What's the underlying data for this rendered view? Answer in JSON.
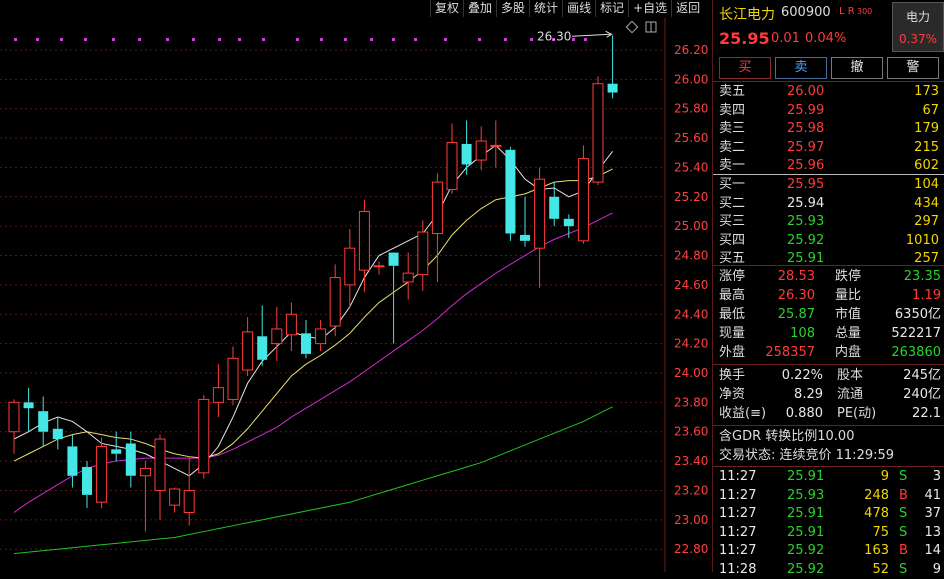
{
  "toolbar": [
    "复权",
    "叠加",
    "多股",
    "统计",
    "画线",
    "标记",
    "+自选",
    "返回"
  ],
  "chart_data": {
    "type": "candlestick",
    "y_ticks": [
      "26.20",
      "26.00",
      "25.80",
      "25.60",
      "25.40",
      "25.20",
      "25.00",
      "24.80",
      "24.60",
      "24.40",
      "24.20",
      "24.00",
      "23.80",
      "23.60",
      "23.40",
      "23.20",
      "23.00",
      "22.80"
    ],
    "ylim": [
      22.74,
      26.37
    ],
    "high_label": "26.30",
    "candles": [
      {
        "o": 23.6,
        "c": 23.8,
        "h": 23.82,
        "l": 23.45
      },
      {
        "o": 23.8,
        "c": 23.76,
        "h": 23.9,
        "l": 23.6
      },
      {
        "o": 23.74,
        "c": 23.6,
        "h": 23.84,
        "l": 23.5
      },
      {
        "o": 23.62,
        "c": 23.55,
        "h": 23.7,
        "l": 23.48
      },
      {
        "o": 23.5,
        "c": 23.3,
        "h": 23.58,
        "l": 23.22
      },
      {
        "o": 23.36,
        "c": 23.17,
        "h": 23.4,
        "l": 23.08
      },
      {
        "o": 23.12,
        "c": 23.5,
        "h": 23.56,
        "l": 23.08
      },
      {
        "o": 23.48,
        "c": 23.45,
        "h": 23.6,
        "l": 23.4
      },
      {
        "o": 23.52,
        "c": 23.3,
        "h": 23.6,
        "l": 23.22
      },
      {
        "o": 23.3,
        "c": 23.35,
        "h": 23.4,
        "l": 22.92
      },
      {
        "o": 23.2,
        "c": 23.55,
        "h": 23.58,
        "l": 23.0
      },
      {
        "o": 23.1,
        "c": 23.21,
        "h": 23.22,
        "l": 23.05
      },
      {
        "o": 23.05,
        "c": 23.2,
        "h": 23.42,
        "l": 22.96
      },
      {
        "o": 23.32,
        "c": 23.82,
        "h": 23.85,
        "l": 23.28
      },
      {
        "o": 23.8,
        "c": 23.9,
        "h": 24.06,
        "l": 23.7
      },
      {
        "o": 23.82,
        "c": 24.1,
        "h": 24.18,
        "l": 23.78
      },
      {
        "o": 24.02,
        "c": 24.28,
        "h": 24.38,
        "l": 23.98
      },
      {
        "o": 24.25,
        "c": 24.09,
        "h": 24.46,
        "l": 24.05
      },
      {
        "o": 24.2,
        "c": 24.3,
        "h": 24.45,
        "l": 24.08
      },
      {
        "o": 24.26,
        "c": 24.4,
        "h": 24.48,
        "l": 24.15
      },
      {
        "o": 24.27,
        "c": 24.13,
        "h": 24.36,
        "l": 24.1
      },
      {
        "o": 24.2,
        "c": 24.3,
        "h": 24.36,
        "l": 24.15
      },
      {
        "o": 24.32,
        "c": 24.65,
        "h": 24.74,
        "l": 24.25
      },
      {
        "o": 24.6,
        "c": 24.85,
        "h": 24.98,
        "l": 24.45
      },
      {
        "o": 24.7,
        "c": 25.1,
        "h": 25.18,
        "l": 24.55
      },
      {
        "o": 24.73,
        "c": 24.73,
        "h": 24.76,
        "l": 24.67
      },
      {
        "o": 24.82,
        "c": 24.73,
        "h": 24.82,
        "l": 24.2
      },
      {
        "o": 24.62,
        "c": 24.68,
        "h": 24.82,
        "l": 24.5
      },
      {
        "o": 24.67,
        "c": 24.96,
        "h": 25.04,
        "l": 24.56
      },
      {
        "o": 24.95,
        "c": 25.3,
        "h": 25.36,
        "l": 24.62
      },
      {
        "o": 25.25,
        "c": 25.57,
        "h": 25.7,
        "l": 25.22
      },
      {
        "o": 25.56,
        "c": 25.42,
        "h": 25.72,
        "l": 25.35
      },
      {
        "o": 25.45,
        "c": 25.58,
        "h": 25.68,
        "l": 25.38
      },
      {
        "o": 25.55,
        "c": 25.55,
        "h": 25.72,
        "l": 25.4
      },
      {
        "o": 25.52,
        "c": 24.95,
        "h": 25.54,
        "l": 24.9
      },
      {
        "o": 24.94,
        "c": 24.9,
        "h": 25.2,
        "l": 24.86
      },
      {
        "o": 24.85,
        "c": 25.32,
        "h": 25.4,
        "l": 24.58
      },
      {
        "o": 25.2,
        "c": 25.05,
        "h": 25.3,
        "l": 25.0
      },
      {
        "o": 25.05,
        "c": 25.0,
        "h": 25.08,
        "l": 24.92
      },
      {
        "o": 24.9,
        "c": 25.46,
        "h": 25.55,
        "l": 24.88
      },
      {
        "o": 25.3,
        "c": 25.97,
        "h": 26.02,
        "l": 25.28
      },
      {
        "o": 25.97,
        "c": 25.91,
        "h": 26.3,
        "l": 25.87
      }
    ],
    "ma5": [
      23.55,
      23.6,
      23.66,
      23.7,
      23.67,
      23.6,
      23.52,
      23.5,
      23.48,
      23.45,
      23.4,
      23.35,
      23.3,
      23.38,
      23.5,
      23.7,
      23.93,
      24.08,
      24.18,
      24.28,
      24.25,
      24.23,
      24.31,
      24.45,
      24.65,
      24.8,
      24.85,
      24.9,
      24.95,
      25.08,
      25.28,
      25.4,
      25.48,
      25.55,
      25.45,
      25.32,
      25.25,
      25.26,
      25.2,
      25.24,
      25.38,
      25.51
    ],
    "ma10": [
      23.4,
      23.45,
      23.5,
      23.55,
      23.58,
      23.6,
      23.58,
      23.56,
      23.55,
      23.52,
      23.48,
      23.45,
      23.43,
      23.42,
      23.45,
      23.52,
      23.62,
      23.74,
      23.86,
      23.98,
      24.06,
      24.12,
      24.19,
      24.27,
      24.38,
      24.48,
      24.55,
      24.62,
      24.7,
      24.8,
      24.94,
      25.04,
      25.12,
      25.18,
      25.2,
      25.22,
      25.26,
      25.3,
      25.31,
      25.31,
      25.34,
      25.39
    ],
    "ma20": [
      23.05,
      23.12,
      23.18,
      23.24,
      23.3,
      23.35,
      23.38,
      23.4,
      23.41,
      23.42,
      23.42,
      23.42,
      23.42,
      23.42,
      23.44,
      23.48,
      23.53,
      23.58,
      23.63,
      23.7,
      23.76,
      23.82,
      23.88,
      23.94,
      24.01,
      24.08,
      24.15,
      24.22,
      24.29,
      24.37,
      24.46,
      24.54,
      24.61,
      24.68,
      24.74,
      24.8,
      24.86,
      24.91,
      24.95,
      24.99,
      25.04,
      25.09
    ],
    "ma60": [
      22.77,
      22.78,
      22.79,
      22.8,
      22.81,
      22.82,
      22.83,
      22.84,
      22.85,
      22.86,
      22.87,
      22.88,
      22.9,
      22.92,
      22.94,
      22.96,
      22.98,
      23.0,
      23.02,
      23.04,
      23.06,
      23.08,
      23.1,
      23.12,
      23.15,
      23.18,
      23.21,
      23.24,
      23.27,
      23.3,
      23.33,
      23.36,
      23.39,
      23.43,
      23.47,
      23.51,
      23.55,
      23.59,
      23.63,
      23.67,
      23.72,
      23.77
    ]
  },
  "quote": {
    "name": "长江电力",
    "code": "600900",
    "tag": "L R",
    "tag_num": "300",
    "sector": "电力",
    "sector_pct": "0.37%",
    "price": "25.95",
    "change": "0.01",
    "pct": "0.04%",
    "buttons": [
      "买",
      "卖",
      "撤",
      "警"
    ],
    "asks": [
      {
        "label": "卖五",
        "price": "26.00",
        "vol": "173"
      },
      {
        "label": "卖四",
        "price": "25.99",
        "vol": "67"
      },
      {
        "label": "卖三",
        "price": "25.98",
        "vol": "179"
      },
      {
        "label": "卖二",
        "price": "25.97",
        "vol": "215"
      },
      {
        "label": "卖一",
        "price": "25.96",
        "vol": "602"
      }
    ],
    "bids": [
      {
        "label": "买一",
        "price": "25.95",
        "vol": "104"
      },
      {
        "label": "买二",
        "price": "25.94",
        "vol": "434"
      },
      {
        "label": "买三",
        "price": "25.93",
        "vol": "297"
      },
      {
        "label": "买四",
        "price": "25.92",
        "vol": "1010"
      },
      {
        "label": "买五",
        "price": "25.91",
        "vol": "257"
      }
    ],
    "stats": [
      {
        "l1": "涨停",
        "v1": "28.53",
        "l2": "跌停",
        "v2": "23.35"
      },
      {
        "l1": "最高",
        "v1": "26.30",
        "l2": "量比",
        "v2": "1.19"
      },
      {
        "l1": "最低",
        "v1": "25.87",
        "l2": "市值",
        "v2": "6350亿"
      },
      {
        "l1": "现量",
        "v1": "108",
        "l2": "总量",
        "v2": "522217"
      },
      {
        "l1": "外盘",
        "v1": "258357",
        "l2": "内盘",
        "v2": "263860"
      }
    ],
    "fund": [
      {
        "l1": "换手",
        "v1": "0.22%",
        "l2": "股本",
        "v2": "245亿"
      },
      {
        "l1": "净资",
        "v1": "8.29",
        "l2": "流通",
        "v2": "240亿"
      },
      {
        "l1": "收益(≡)",
        "v1": "0.880",
        "l2": "PE(动)",
        "v2": "22.1"
      }
    ],
    "gdr": "含GDR 转换比例10.00",
    "trade_status": "交易状态: 连续竞价 11:29:59",
    "ticks": [
      {
        "t": "11:27",
        "p": "25.91",
        "v": "9",
        "bs": "S",
        "n": "3"
      },
      {
        "t": "11:27",
        "p": "25.93",
        "v": "248",
        "bs": "B",
        "n": "41"
      },
      {
        "t": "11:27",
        "p": "25.91",
        "v": "478",
        "bs": "S",
        "n": "37"
      },
      {
        "t": "11:27",
        "p": "25.91",
        "v": "75",
        "bs": "S",
        "n": "13"
      },
      {
        "t": "11:27",
        "p": "25.92",
        "v": "163",
        "bs": "B",
        "n": "14"
      },
      {
        "t": "11:28",
        "p": "25.92",
        "v": "52",
        "bs": "S",
        "n": "9"
      }
    ]
  }
}
